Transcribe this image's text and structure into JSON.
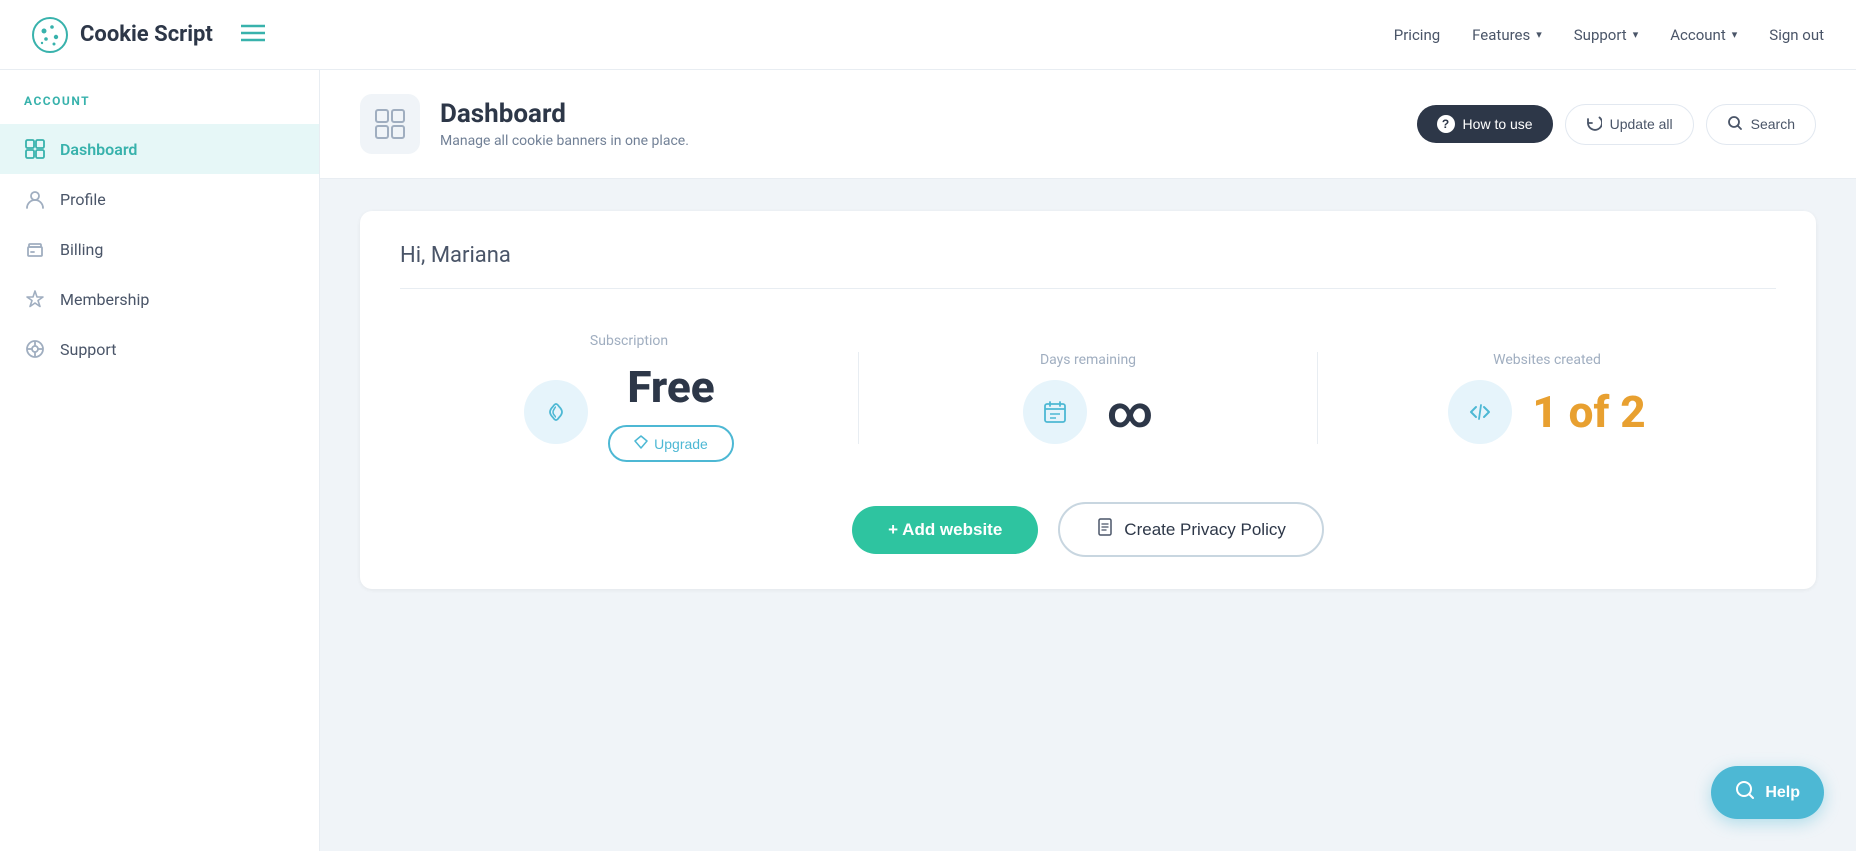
{
  "brand": {
    "name": "Cookie Script"
  },
  "topnav": {
    "pricing": "Pricing",
    "features": "Features",
    "support": "Support",
    "account": "Account",
    "signout": "Sign out"
  },
  "sidebar": {
    "section_title": "ACCOUNT",
    "items": [
      {
        "id": "dashboard",
        "label": "Dashboard",
        "active": true
      },
      {
        "id": "profile",
        "label": "Profile",
        "active": false
      },
      {
        "id": "billing",
        "label": "Billing",
        "active": false
      },
      {
        "id": "membership",
        "label": "Membership",
        "active": false
      },
      {
        "id": "support",
        "label": "Support",
        "active": false
      }
    ]
  },
  "dashboard": {
    "title": "Dashboard",
    "subtitle": "Manage all cookie banners in one place.",
    "how_to_use": "How to use",
    "update_all": "Update all",
    "search": "Search"
  },
  "greeting": "Hi, Mariana",
  "stats": {
    "subscription": {
      "label": "Subscription",
      "value": "Free",
      "upgrade_label": "Upgrade"
    },
    "days_remaining": {
      "label": "Days remaining",
      "value": "∞"
    },
    "websites_created": {
      "label": "Websites created",
      "current": "1",
      "separator": " of ",
      "max": "2"
    }
  },
  "actions": {
    "add_website": "+ Add website",
    "create_policy": "Create Privacy Policy"
  },
  "help": {
    "label": "Help"
  }
}
